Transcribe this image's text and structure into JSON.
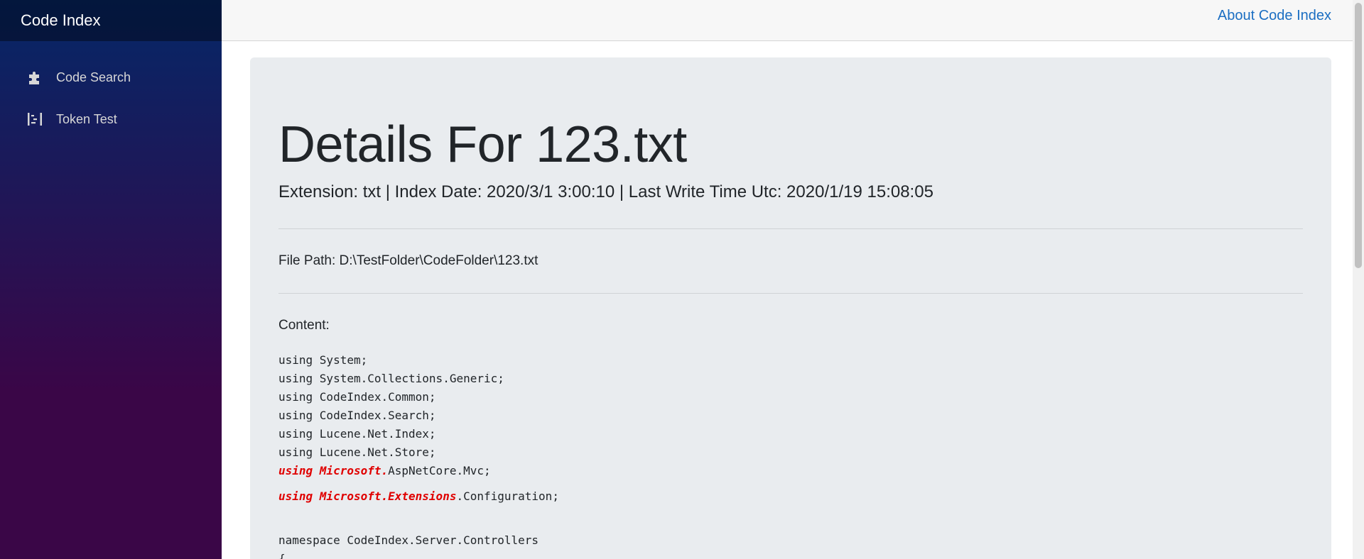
{
  "brand": {
    "title": "Code Index"
  },
  "sidebar": {
    "items": [
      {
        "label": "Code Search",
        "icon": "puzzle-icon"
      },
      {
        "label": "Token Test",
        "icon": "token-icon"
      }
    ]
  },
  "topbar": {
    "about_label": "About Code Index"
  },
  "details": {
    "title": "Details For 123.txt",
    "meta": "Extension: txt | Index Date: 2020/3/1 3:00:10 | Last Write Time Utc: 2020/1/19 15:08:05",
    "file_path": "File Path: D:\\TestFolder\\CodeFolder\\123.txt",
    "content_label": "Content:"
  },
  "code": {
    "lines": [
      "using System;",
      "using System.Collections.Generic;",
      "using CodeIndex.Common;",
      "using CodeIndex.Search;",
      "using Lucene.Net.Index;",
      "using Lucene.Net.Store;"
    ],
    "hl_line_1": {
      "highlight": "using Microsoft.",
      "rest": "AspNetCore.Mvc;"
    },
    "hl_line_2": {
      "highlight": "using Microsoft.Extensions",
      "rest": ".Configuration;"
    },
    "namespace_line": "namespace CodeIndex.Server.Controllers",
    "brace_line": "{"
  },
  "colors": {
    "accent_link": "#1b6ec2",
    "highlight": "#e00000",
    "sidebar_top": "#052767",
    "sidebar_bottom": "#3a0647"
  }
}
